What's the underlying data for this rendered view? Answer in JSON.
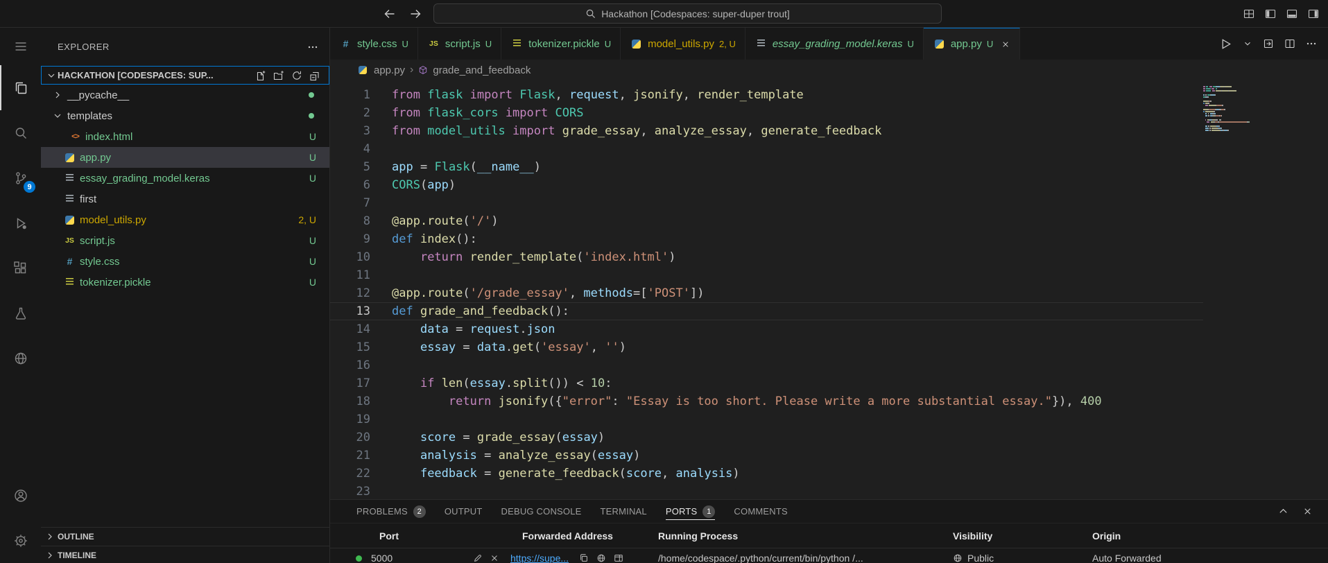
{
  "title_bar": {
    "search_text": "Hackathon [Codespaces: super-duper trout]"
  },
  "activity_bar": {
    "scm_badge": "9",
    "items": [
      "menu",
      "explorer",
      "search",
      "source-control",
      "run-and-debug",
      "extensions",
      "testing",
      "remote-explorer",
      "accounts",
      "settings"
    ]
  },
  "sidebar": {
    "header": "EXPLORER",
    "section": "HACKATHON [CODESPACES: SUP...",
    "outline_label": "OUTLINE",
    "timeline_label": "TIMELINE",
    "files": [
      {
        "name": "__pycache__",
        "type": "folder",
        "collapsed": true,
        "dot": true
      },
      {
        "name": "templates",
        "type": "folder",
        "collapsed": false,
        "dot": true
      },
      {
        "name": "index.html",
        "icon": "html",
        "badge": "U",
        "indent": 1,
        "color": "green"
      },
      {
        "name": "app.py",
        "icon": "python",
        "badge": "U",
        "indent": 0,
        "color": "green",
        "selected": true
      },
      {
        "name": "essay_grading_model.keras",
        "icon": "file-gray",
        "badge": "U",
        "indent": 0,
        "color": "green"
      },
      {
        "name": "first",
        "icon": "file-gray",
        "badge": "",
        "indent": 0,
        "color": "plain"
      },
      {
        "name": "model_utils.py",
        "icon": "python",
        "badge": "2, U",
        "indent": 0,
        "color": "yellow"
      },
      {
        "name": "script.js",
        "icon": "js",
        "badge": "U",
        "indent": 0,
        "color": "green"
      },
      {
        "name": "style.css",
        "icon": "css",
        "badge": "U",
        "indent": 0,
        "color": "green"
      },
      {
        "name": "tokenizer.pickle",
        "icon": "file-yellow",
        "badge": "U",
        "indent": 0,
        "color": "green"
      }
    ]
  },
  "tabs": [
    {
      "name": "style.css",
      "icon": "css",
      "badge": "U",
      "color": "green"
    },
    {
      "name": "script.js",
      "icon": "js",
      "badge": "U",
      "color": "green"
    },
    {
      "name": "tokenizer.pickle",
      "icon": "file-yellow",
      "badge": "U",
      "color": "green"
    },
    {
      "name": "model_utils.py",
      "icon": "python",
      "badge": "2, U",
      "color": "yellow"
    },
    {
      "name": "essay_grading_model.keras",
      "icon": "file-gray",
      "badge": "U",
      "color": "green",
      "italic": true
    },
    {
      "name": "app.py",
      "icon": "python",
      "badge": "U",
      "color": "green",
      "active": true,
      "close": true
    }
  ],
  "breadcrumb": {
    "file": "app.py",
    "symbol": "grade_and_feedback"
  },
  "editor": {
    "current_line": 13,
    "lines": [
      {
        "n": 1,
        "s": [
          [
            "k",
            "from"
          ],
          [
            "p",
            " "
          ],
          [
            "c",
            "flask"
          ],
          [
            "p",
            " "
          ],
          [
            "k",
            "import"
          ],
          [
            "p",
            " "
          ],
          [
            "c",
            "Flask"
          ],
          [
            "p",
            ", "
          ],
          [
            "v",
            "request"
          ],
          [
            "p",
            ", "
          ],
          [
            "f",
            "jsonify"
          ],
          [
            "p",
            ", "
          ],
          [
            "f",
            "render_template"
          ]
        ]
      },
      {
        "n": 2,
        "s": [
          [
            "k",
            "from"
          ],
          [
            "p",
            " "
          ],
          [
            "c",
            "flask_cors"
          ],
          [
            "p",
            " "
          ],
          [
            "k",
            "import"
          ],
          [
            "p",
            " "
          ],
          [
            "c",
            "CORS"
          ]
        ]
      },
      {
        "n": 3,
        "s": [
          [
            "k",
            "from"
          ],
          [
            "p",
            " "
          ],
          [
            "c",
            "model_utils"
          ],
          [
            "p",
            " "
          ],
          [
            "k",
            "import"
          ],
          [
            "p",
            " "
          ],
          [
            "f",
            "grade_essay"
          ],
          [
            "p",
            ", "
          ],
          [
            "f",
            "analyze_essay"
          ],
          [
            "p",
            ", "
          ],
          [
            "f",
            "generate_feedback"
          ]
        ]
      },
      {
        "n": 4,
        "s": []
      },
      {
        "n": 5,
        "s": [
          [
            "v",
            "app"
          ],
          [
            "p",
            " "
          ],
          [
            "o",
            "="
          ],
          [
            "p",
            " "
          ],
          [
            "c",
            "Flask"
          ],
          [
            "p",
            "("
          ],
          [
            "v",
            "__name__"
          ],
          [
            "p",
            ")"
          ]
        ]
      },
      {
        "n": 6,
        "s": [
          [
            "c",
            "CORS"
          ],
          [
            "p",
            "("
          ],
          [
            "v",
            "app"
          ],
          [
            "p",
            ")"
          ]
        ]
      },
      {
        "n": 7,
        "s": []
      },
      {
        "n": 8,
        "s": [
          [
            "f",
            "@app.route"
          ],
          [
            "p",
            "("
          ],
          [
            "s",
            "'/'"
          ],
          [
            "p",
            ")"
          ]
        ]
      },
      {
        "n": 9,
        "s": [
          [
            "d",
            "def"
          ],
          [
            "p",
            " "
          ],
          [
            "f",
            "index"
          ],
          [
            "p",
            "():"
          ]
        ]
      },
      {
        "n": 10,
        "s": [
          [
            "p",
            "    "
          ],
          [
            "k",
            "return"
          ],
          [
            "p",
            " "
          ],
          [
            "f",
            "render_template"
          ],
          [
            "p",
            "("
          ],
          [
            "s",
            "'index.html'"
          ],
          [
            "p",
            ")"
          ]
        ]
      },
      {
        "n": 11,
        "s": []
      },
      {
        "n": 12,
        "s": [
          [
            "f",
            "@app.route"
          ],
          [
            "p",
            "("
          ],
          [
            "s",
            "'/grade_essay'"
          ],
          [
            "p",
            ", "
          ],
          [
            "v",
            "methods"
          ],
          [
            "o",
            "="
          ],
          [
            "p",
            "["
          ],
          [
            "s",
            "'POST'"
          ],
          [
            "p",
            "])"
          ]
        ]
      },
      {
        "n": 13,
        "s": [
          [
            "d",
            "def"
          ],
          [
            "p",
            " "
          ],
          [
            "f",
            "grade_and_feedback"
          ],
          [
            "p",
            "():"
          ]
        ]
      },
      {
        "n": 14,
        "s": [
          [
            "p",
            "    "
          ],
          [
            "v",
            "data"
          ],
          [
            "p",
            " "
          ],
          [
            "o",
            "="
          ],
          [
            "p",
            " "
          ],
          [
            "v",
            "request"
          ],
          [
            "p",
            "."
          ],
          [
            "v",
            "json"
          ]
        ]
      },
      {
        "n": 15,
        "s": [
          [
            "p",
            "    "
          ],
          [
            "v",
            "essay"
          ],
          [
            "p",
            " "
          ],
          [
            "o",
            "="
          ],
          [
            "p",
            " "
          ],
          [
            "v",
            "data"
          ],
          [
            "p",
            "."
          ],
          [
            "f",
            "get"
          ],
          [
            "p",
            "("
          ],
          [
            "s",
            "'essay'"
          ],
          [
            "p",
            ", "
          ],
          [
            "s",
            "''"
          ],
          [
            "p",
            ")"
          ]
        ]
      },
      {
        "n": 16,
        "s": []
      },
      {
        "n": 17,
        "s": [
          [
            "p",
            "    "
          ],
          [
            "k",
            "if"
          ],
          [
            "p",
            " "
          ],
          [
            "f",
            "len"
          ],
          [
            "p",
            "("
          ],
          [
            "v",
            "essay"
          ],
          [
            "p",
            "."
          ],
          [
            "f",
            "split"
          ],
          [
            "p",
            "()) "
          ],
          [
            "o",
            "<"
          ],
          [
            "p",
            " "
          ],
          [
            "n",
            "10"
          ],
          [
            "p",
            ":"
          ]
        ]
      },
      {
        "n": 18,
        "s": [
          [
            "p",
            "        "
          ],
          [
            "k",
            "return"
          ],
          [
            "p",
            " "
          ],
          [
            "f",
            "jsonify"
          ],
          [
            "p",
            "({"
          ],
          [
            "s",
            "\"error\""
          ],
          [
            "p",
            ": "
          ],
          [
            "s",
            "\"Essay is too short. Please write a more substantial essay.\""
          ],
          [
            "p",
            "}), "
          ],
          [
            "n",
            "400"
          ]
        ]
      },
      {
        "n": 19,
        "s": []
      },
      {
        "n": 20,
        "s": [
          [
            "p",
            "    "
          ],
          [
            "v",
            "score"
          ],
          [
            "p",
            " "
          ],
          [
            "o",
            "="
          ],
          [
            "p",
            " "
          ],
          [
            "f",
            "grade_essay"
          ],
          [
            "p",
            "("
          ],
          [
            "v",
            "essay"
          ],
          [
            "p",
            ")"
          ]
        ]
      },
      {
        "n": 21,
        "s": [
          [
            "p",
            "    "
          ],
          [
            "v",
            "analysis"
          ],
          [
            "p",
            " "
          ],
          [
            "o",
            "="
          ],
          [
            "p",
            " "
          ],
          [
            "f",
            "analyze_essay"
          ],
          [
            "p",
            "("
          ],
          [
            "v",
            "essay"
          ],
          [
            "p",
            ")"
          ]
        ]
      },
      {
        "n": 22,
        "s": [
          [
            "p",
            "    "
          ],
          [
            "v",
            "feedback"
          ],
          [
            "p",
            " "
          ],
          [
            "o",
            "="
          ],
          [
            "p",
            " "
          ],
          [
            "f",
            "generate_feedback"
          ],
          [
            "p",
            "("
          ],
          [
            "v",
            "score"
          ],
          [
            "p",
            ", "
          ],
          [
            "v",
            "analysis"
          ],
          [
            "p",
            ")"
          ]
        ]
      },
      {
        "n": 23,
        "s": []
      }
    ]
  },
  "panel": {
    "tabs": [
      {
        "label": "PROBLEMS",
        "badge": "2"
      },
      {
        "label": "OUTPUT"
      },
      {
        "label": "DEBUG CONSOLE"
      },
      {
        "label": "TERMINAL"
      },
      {
        "label": "PORTS",
        "badge": "1",
        "active": true
      },
      {
        "label": "COMMENTS"
      }
    ],
    "ports": {
      "columns": [
        "Port",
        "Forwarded Address",
        "Running Process",
        "Visibility",
        "Origin"
      ],
      "rows": [
        {
          "port": "5000",
          "address": "https://supe...",
          "process": "/home/codespace/.python/current/bin/python /...",
          "visibility": "Public",
          "origin": "Auto Forwarded"
        }
      ]
    }
  },
  "colors": {
    "syntax": {
      "k": "#C586C0",
      "d": "#569CD6",
      "f": "#DCDCAA",
      "c": "#4EC9B0",
      "v": "#9CDCFE",
      "s": "#CE9178",
      "n": "#B5CEA8",
      "p": "#CCCCCC",
      "o": "#D4D4D4"
    },
    "git_untracked": "#73C991",
    "warning": "#CCA700",
    "accent": "#0078D4",
    "link": "#4DAAFC",
    "port_dot": "#3FB950",
    "symbol_method": "#B180D7"
  }
}
